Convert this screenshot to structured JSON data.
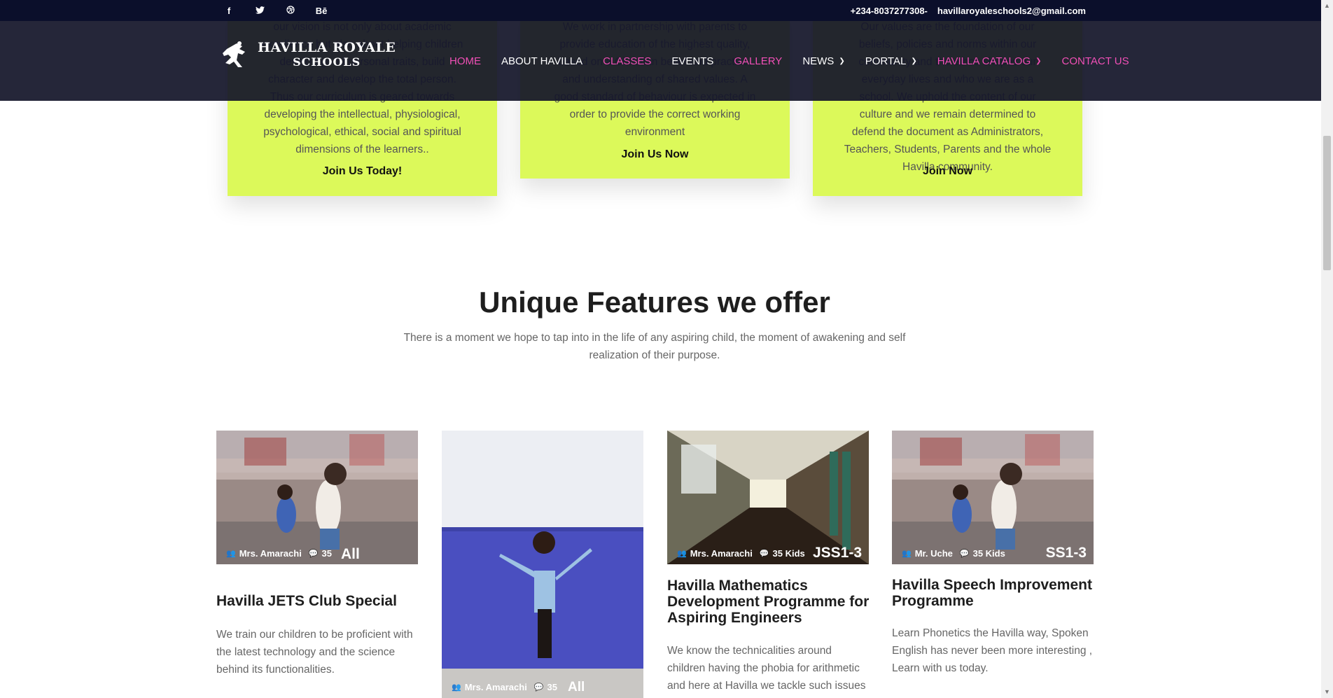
{
  "topbar": {
    "social": [
      {
        "icon": "facebook-icon",
        "glyph": "f"
      },
      {
        "icon": "twitter-icon",
        "glyph": "🐦"
      },
      {
        "icon": "dribbble-icon",
        "glyph": "◎"
      },
      {
        "icon": "behance-icon",
        "glyph": "Bē"
      }
    ],
    "phone": "+234-8037277308-",
    "email": "havillaroyaleschools2@gmail.com"
  },
  "header": {
    "logo_line1": "HAVILLA ROYALE",
    "logo_line2": "SCHOOLS",
    "nav": [
      {
        "label": "HOME",
        "color": "pink"
      },
      {
        "label": "ABOUT HAVILLA",
        "color": "white"
      },
      {
        "label": "CLASSES",
        "color": "pink"
      },
      {
        "label": "EVENTS",
        "color": "white"
      },
      {
        "label": "GALLERY",
        "color": "pink"
      },
      {
        "label": "NEWS",
        "color": "white",
        "dropdown": true
      },
      {
        "label": "PORTAL",
        "color": "white",
        "dropdown": true
      },
      {
        "label": "HAVILLA CATALOG",
        "color": "pink",
        "dropdown": true
      },
      {
        "label": "CONTACT US",
        "color": "pink"
      }
    ]
  },
  "cards": [
    {
      "body": "our vision is not only about academic excellence but also about helping children develop good personal traits, build character and develop the total person. Thus our curriculum is geared towards developing the intellectual, physiological, psychological, ethical, social and spiritual dimensions of the learners..",
      "cta": "Join Us Today!"
    },
    {
      "body": "We work in partnership with parents to provide education of the highest quality, based on a Christian belief and practice, and understanding of shared values. A good standard of behaviour is expected in order to provide the correct working environment",
      "cta": "Join Us Now"
    },
    {
      "body": "Our values are the foundation of our beliefs, policies and norms within our community and the ethos shapes our everyday lives and who we are as a school. We uphold the content of our culture and we remain determined to defend the document as Administrators, Teachers, Students, Parents and the whole Havilla community.",
      "cta": "Join Now"
    }
  ],
  "section": {
    "title": "Unique Features we offer",
    "subtitle": "There is a moment we hope to tap into in the life of any aspiring child, the moment of awakening and self realization of their purpose."
  },
  "features": [
    {
      "teacher": "Mrs. Amarachi",
      "count": "35",
      "tag": "All",
      "title": "Havilla JETS Club Special",
      "desc": "We train our children to be proficient with the latest technology and the science behind its functionalities."
    },
    {
      "teacher": "Mrs. Amarachi",
      "count": "35",
      "tag": "All",
      "title": "",
      "desc": ""
    },
    {
      "teacher": "Mrs. Amarachi",
      "count": "35 Kids",
      "tag": "JSS1-3",
      "title": "Havilla Mathematics Development Programme for Aspiring Engineers",
      "desc": "We know the technicalities around children having the phobia for arithmetic and here at Havilla we tackle such issues"
    },
    {
      "teacher": "Mr. Uche",
      "count": "35 Kids",
      "tag": "SS1-3",
      "title": "Havilla Speech Improvement Programme",
      "desc": "Learn Phonetics the Havilla way, Spoken English has never been more interesting , Learn with us today."
    }
  ],
  "colors": {
    "topbar": "#0b0f2b",
    "header": "#14162a",
    "accent_pink": "#f04fb6",
    "card_green": "#dcf95a"
  }
}
